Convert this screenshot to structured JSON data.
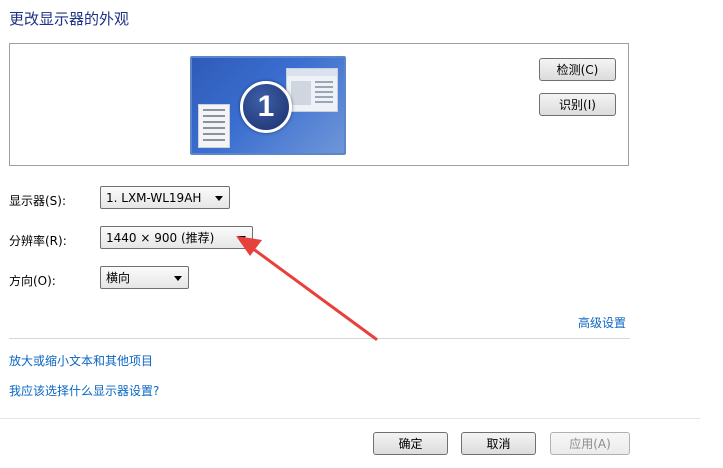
{
  "header": {
    "title": "更改显示器的外观"
  },
  "preview": {
    "monitor_number": "1",
    "detect_label": "检测(C)",
    "identify_label": "识别(I)"
  },
  "settings": {
    "display": {
      "label": "显示器(S):",
      "value": "1. LXM-WL19AH"
    },
    "resolution": {
      "label": "分辨率(R):",
      "value": "1440 × 900 (推荐)"
    },
    "orientation": {
      "label": "方向(O):",
      "value": "横向"
    }
  },
  "links": {
    "advanced": "高级设置",
    "enlarge_text": "放大或缩小文本和其他项目",
    "which_settings": "我应该选择什么显示器设置?"
  },
  "footer": {
    "ok_label": "确定",
    "cancel_label": "取消",
    "apply_label": "应用(A)"
  },
  "annotation": {
    "arrow_color": "#e8403a"
  }
}
